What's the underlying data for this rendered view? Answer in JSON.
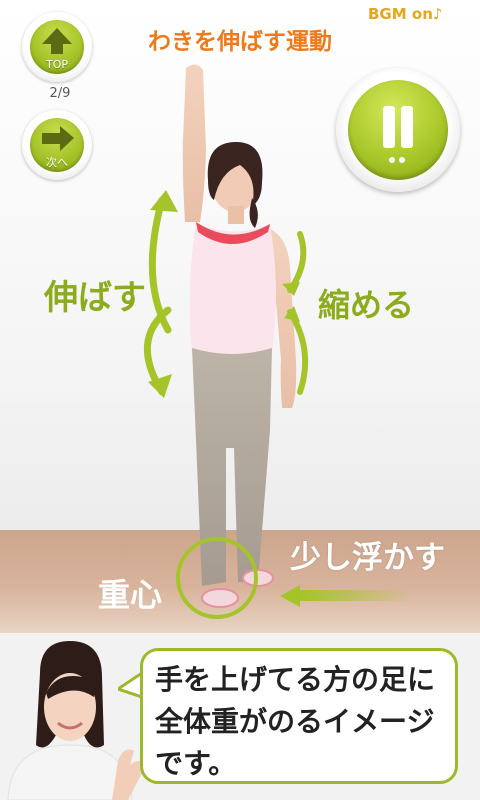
{
  "header": {
    "title": "わきを伸ばす運動",
    "bgm_label": "BGM on♪",
    "progress": "2/9"
  },
  "nav": {
    "top_label": "TOP",
    "next_label": "次へ"
  },
  "player": {
    "state": "playing",
    "button": "pause"
  },
  "annotations": {
    "stretch": "伸ばす",
    "shrink": "縮める",
    "float": "少し浮かす",
    "center_of_gravity": "重心"
  },
  "instructor": {
    "speech": "手を上げてる方の足に全体重がのるイメージです。"
  },
  "colors": {
    "accent_green": "#a5c42a",
    "title_orange": "#ef7a1a",
    "bgm_yellow": "#e6a617"
  }
}
